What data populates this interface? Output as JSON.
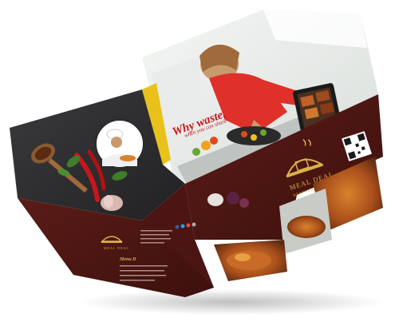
{
  "brochure": {
    "headline": "Why waste,",
    "subheadline": "when you can share",
    "brand_name": "MEAL DEAL",
    "brand_tagline": "RESTAURANT",
    "small_brand_name": "MEAL DEAL",
    "section_heading": "Menu D",
    "colors": {
      "maroon": "#4a1512",
      "maroon_light": "#5e1d18",
      "gold": "#d9b24a",
      "red_headline": "#c8161d",
      "chalkboard": "#2e2e30",
      "shirt_red": "#e0302a"
    },
    "icons": [
      "chef-hat-logo-icon",
      "qr-code-icon",
      "smartphone-app-icon",
      "social-icons"
    ]
  }
}
